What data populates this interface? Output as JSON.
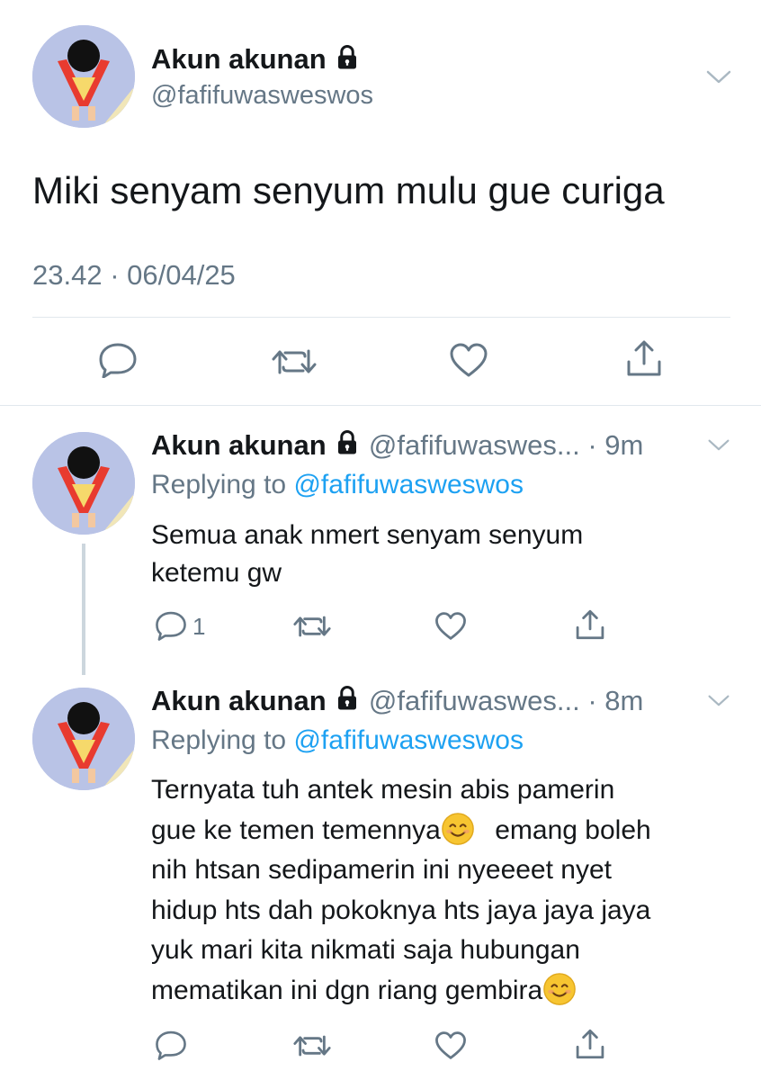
{
  "main_tweet": {
    "display_name": "Akun akunan",
    "handle": "@fafifuwasweswos",
    "text": "Miki senyam senyum mulu gue curiga",
    "timestamp": "23.42 · 06/04/25",
    "icons": [
      "reply-icon",
      "retweet-icon",
      "like-icon",
      "share-icon"
    ]
  },
  "replies": [
    {
      "display_name": "Akun akunan",
      "handle": "@fafifuwaswes...",
      "time": "· 9m",
      "replying_label": "Replying to",
      "replying_to": "@fafifuwasweswos",
      "lines": [
        "Semua anak nmert senyam senyum",
        "ketemu gw"
      ],
      "reply_count": "1"
    },
    {
      "display_name": "Akun akunan",
      "handle": "@fafifuwaswes...",
      "time": "· 8m",
      "replying_label": "Replying to",
      "replying_to": "@fafifuwasweswos",
      "lines": [
        "Ternyata tuh antek mesin abis pamerin",
        "gue ke temen temennya",
        "emang boleh",
        "nih htsan sedipamerin ini nyeeeet nyet",
        "hidup hts dah pokoknya hts jaya jaya jaya",
        "yuk mari kita nikmati saja hubungan",
        "mematikan ini dgn riang gembira"
      ],
      "emojis": [
        "smiling-face-emoji",
        "smiling-face-emoji"
      ]
    }
  ],
  "colors": {
    "link": "#1da1f2",
    "muted": "#657786",
    "text": "#14171a",
    "divider": "#e1e8ed",
    "thread_line": "#ccd6dd"
  }
}
